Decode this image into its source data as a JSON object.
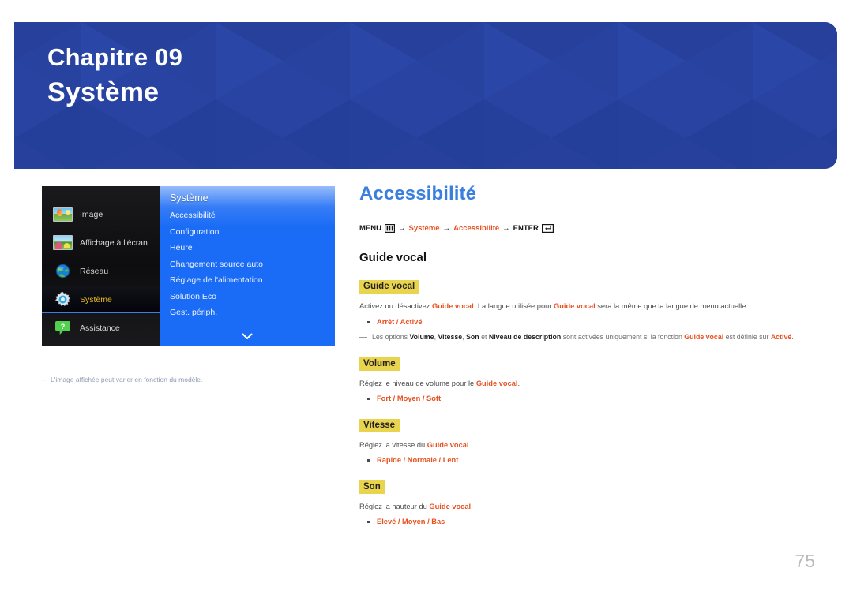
{
  "header": {
    "chapter_number": "Chapitre 09",
    "chapter_title": "Système",
    "band_color": "#26409c"
  },
  "osd": {
    "categories": [
      {
        "label": "Image",
        "icon": "picture-thumbnail-icon",
        "selected": false
      },
      {
        "label": "Affichage à l'écran",
        "icon": "osd-thumbnail-icon",
        "selected": false
      },
      {
        "label": "Réseau",
        "icon": "globe-icon",
        "selected": false
      },
      {
        "label": "Système",
        "icon": "gear-icon",
        "selected": true
      },
      {
        "label": "Assistance",
        "icon": "help-bubble-icon",
        "selected": false
      }
    ],
    "panel_title": "Système",
    "items": [
      "Accessibilité",
      "Configuration",
      "Heure",
      "Changement source auto",
      "Réglage de l'alimentation",
      "Solution Eco",
      "Gest. périph."
    ],
    "scroll_icon": "chevron-down-icon",
    "selected_label_color": "#e8b823",
    "panel_color": "#1a6bf5"
  },
  "mock_note": {
    "dash": "‒",
    "text": "L'image affichée peut varier en fonction du modèle."
  },
  "content": {
    "title": "Accessibilité",
    "breadcrumb": {
      "menu_label": "MENU",
      "menu_icon": "menu-bars-icon",
      "arrow1": "→",
      "step1": "Système",
      "arrow2": "→",
      "step2": "Accessibilité",
      "arrow3": "→",
      "enter_label": "ENTER",
      "enter_icon": "enter-return-icon"
    },
    "heading": "Guide vocal",
    "sections": [
      {
        "badge": "Guide vocal",
        "desc_a": "Activez ou désactivez ",
        "desc_b": "Guide vocal",
        "desc_c": ". La langue utilisée pour ",
        "desc_d": "Guide vocal",
        "desc_e": " sera la même que la langue de menu actuelle.",
        "options": "Arrêt / Activé",
        "note": {
          "dash": "—",
          "t1": "Les options ",
          "o1": "Volume",
          "t2": ", ",
          "o2": "Vitesse",
          "t3": ", ",
          "o3": "Son",
          "t4": " et ",
          "o4": "Niveau de description",
          "t5": " sont activées uniquement si la fonction ",
          "o5": "Guide vocal",
          "t6": " est définie sur ",
          "o6": "Activé",
          "t7": "."
        }
      },
      {
        "badge": "Volume",
        "desc_a": "Réglez le niveau de volume pour le ",
        "desc_b": "Guide vocal",
        "desc_c": ".",
        "options": "Fort / Moyen / Soft"
      },
      {
        "badge": "Vitesse",
        "desc_a": "Réglez la vitesse du ",
        "desc_b": "Guide vocal",
        "desc_c": ".",
        "options": "Rapide / Normale / Lent"
      },
      {
        "badge": "Son",
        "desc_a": "Réglez la hauteur du ",
        "desc_b": "Guide vocal",
        "desc_c": ".",
        "options": "Elevé / Moyen / Bas"
      }
    ]
  },
  "page_number": "75",
  "colors": {
    "accent_blue": "#3a7fe0",
    "accent_orange": "#e8501e",
    "highlight_yellow": "#e8d44d"
  }
}
